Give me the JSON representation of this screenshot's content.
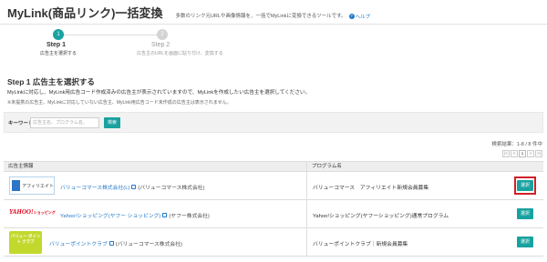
{
  "header": {
    "title": "MyLink(商品リンク)一括変換",
    "description": "多数のリンク元URLや画像情報を、一括でMyLinkに変換できるツールです。",
    "help_label": "ヘルプ"
  },
  "steps": [
    {
      "num": "1",
      "label": "Step 1",
      "sub": "広告主を選択する"
    },
    {
      "num": "2",
      "label": "Step 2",
      "sub": "広告主のURLを画面に貼り付け、変換する"
    }
  ],
  "section": {
    "title": "Step 1 広告主を選択する",
    "desc1": "MyLinkに対応し、MyLink用広告コード作成済みの広告主が表示されていますので、MyLinkを作成したい広告主を選択してください。",
    "desc2": "※未提携の広告主、MyLinkに対応していない広告主、MyLink用広告コード未作成の広告主は表示されません。"
  },
  "search": {
    "label": "キーワード",
    "placeholder": "広告主名、プログラム名、",
    "button": "検索"
  },
  "result": {
    "count_label": "検索結果：1-8 / 8 件中",
    "pager": [
      "|<",
      "<",
      "1",
      ">",
      ">|"
    ]
  },
  "table": {
    "headers": [
      "広告主情報",
      "プログラム名"
    ],
    "rows": [
      {
        "logo_text": "アフィリエイト",
        "name": "バリューコマース株式会社(L)",
        "company": "(バリューコマース株式会社)",
        "program": "バリューコマース　アフィリエイト新規会員募集",
        "select": "選択"
      },
      {
        "logo_text": "YAHOO!",
        "logo_sub": "ショッピング",
        "name": "Yahoo!ショッピング(ヤフー ショッピング)",
        "company": "(ヤフー株式会社)",
        "program": "Yahoo!ショッピング(ヤフーショッピング)通常プログラム",
        "select": "選択"
      },
      {
        "logo_text": "バリュー ポイント クラブ",
        "name": "バリューポイントクラブ",
        "company": "(バリューコマース株式会社)",
        "program": "バリューポイントクラブ｜新規会員募集",
        "select": "選択"
      }
    ]
  },
  "colors": {
    "accent": "#18a2a0",
    "link": "#1f78c8",
    "highlight": "#d0202a"
  }
}
